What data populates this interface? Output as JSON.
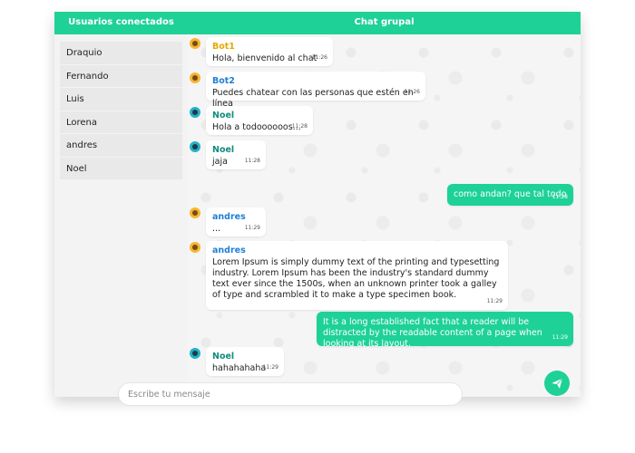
{
  "header": {
    "users_title": "Usuarios conectados",
    "chat_title": "Chat grupal"
  },
  "sidebar": {
    "users": [
      "Draquio",
      "Fernando",
      "Luis",
      "Lorena",
      "andres",
      "Noel"
    ]
  },
  "messages": [
    {
      "name": "Bot1",
      "name_color": "yellow",
      "avatar": "bot-avatar-icon",
      "text": "Hola, bienvenido al chat",
      "time": "11:26"
    },
    {
      "name": "Bot2",
      "name_color": "blue",
      "avatar": "bot-avatar-icon",
      "text": "Puedes chatear con las personas que estén en línea",
      "time": "11:26"
    },
    {
      "name": "Noel",
      "name_color": "teal",
      "avatar": "user-avatar-icon",
      "text": "Hola a todoooooos...",
      "time": "11:28"
    },
    {
      "name": "Noel",
      "name_color": "teal",
      "avatar": "user-avatar-icon",
      "text": "jaja",
      "time": "11:28"
    },
    {
      "own": true,
      "text": "como andan? que tal todo",
      "time": "11:28"
    },
    {
      "name": "andres",
      "name_color": "blue",
      "avatar": "bot-avatar-icon",
      "text": "...",
      "time": "11:29"
    },
    {
      "name": "andres",
      "name_color": "blue",
      "avatar": "bot-avatar-icon",
      "text": "Lorem Ipsum is simply dummy text of the printing and typesetting industry. Lorem Ipsum has been the industry's standard dummy text ever since the 1500s, when an unknown printer took a galley of type and scrambled it to make a type specimen book.",
      "time": "11:29"
    },
    {
      "own": true,
      "text": "It is a long established fact that a reader will be distracted by the readable content of a page when looking at its layout.",
      "time": "11:29"
    },
    {
      "name": "Noel",
      "name_color": "teal",
      "avatar": "user-avatar-icon",
      "text": "hahahahaha",
      "time": "11:29"
    }
  ],
  "composer": {
    "placeholder": "Escribe tu mensaje",
    "value": ""
  },
  "colors": {
    "accent": "#1ed197"
  },
  "icons": {
    "send": "send-icon"
  }
}
